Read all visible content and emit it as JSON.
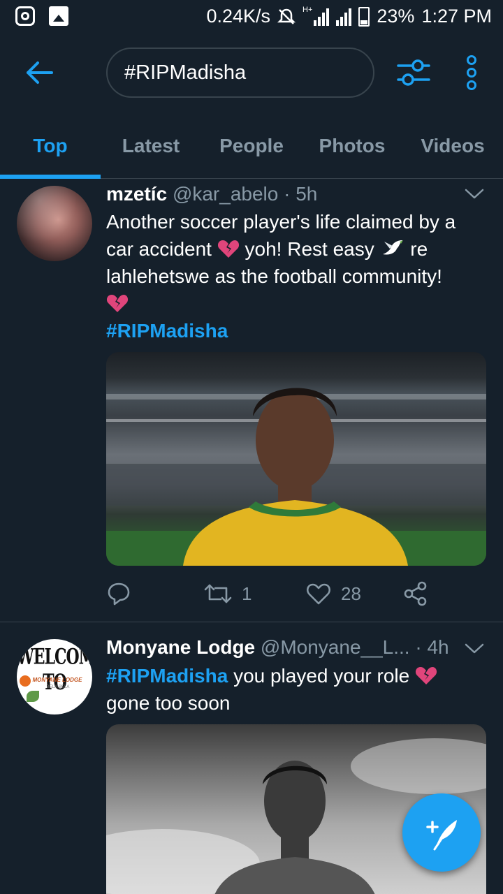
{
  "status_bar": {
    "network_speed": "0.24K/s",
    "battery": "23%",
    "time": "1:27 PM",
    "network_type": "H+"
  },
  "header": {
    "search_query": "#RIPMadisha"
  },
  "tabs": [
    {
      "label": "Top",
      "active": true
    },
    {
      "label": "Latest",
      "active": false
    },
    {
      "label": "People",
      "active": false
    },
    {
      "label": "Photos",
      "active": false
    },
    {
      "label": "Videos",
      "active": false
    }
  ],
  "tweets": [
    {
      "name": "mzetíc",
      "handle": "@kar_abelo",
      "separator": "·",
      "time": "5h",
      "text_line1": "Another soccer player's life claimed by a",
      "text_line2a": "car accident",
      "text_line2b": "yoh! Rest easy",
      "text_line2c": "re",
      "text_line3": "lahlehetswe as the football community!",
      "hashtag": "#RIPMadisha",
      "retweets": "1",
      "likes": "28"
    },
    {
      "name": "Monyane Lodge",
      "handle": "@Monyane__L...",
      "separator": "·",
      "time": "4h",
      "hashtag": "#RIPMadisha",
      "text_a": "you played your role",
      "text_b": "gone too soon",
      "avatar_welcome": "WELCOME TO",
      "avatar_lodge": "MONYANE LODGE",
      "avatar_town": "BELA-BELA"
    }
  ],
  "colors": {
    "background": "#15202b",
    "accent": "#1da1f2",
    "secondary_text": "#8899a6",
    "border": "#38444d",
    "broken_heart": "#e0457b"
  }
}
